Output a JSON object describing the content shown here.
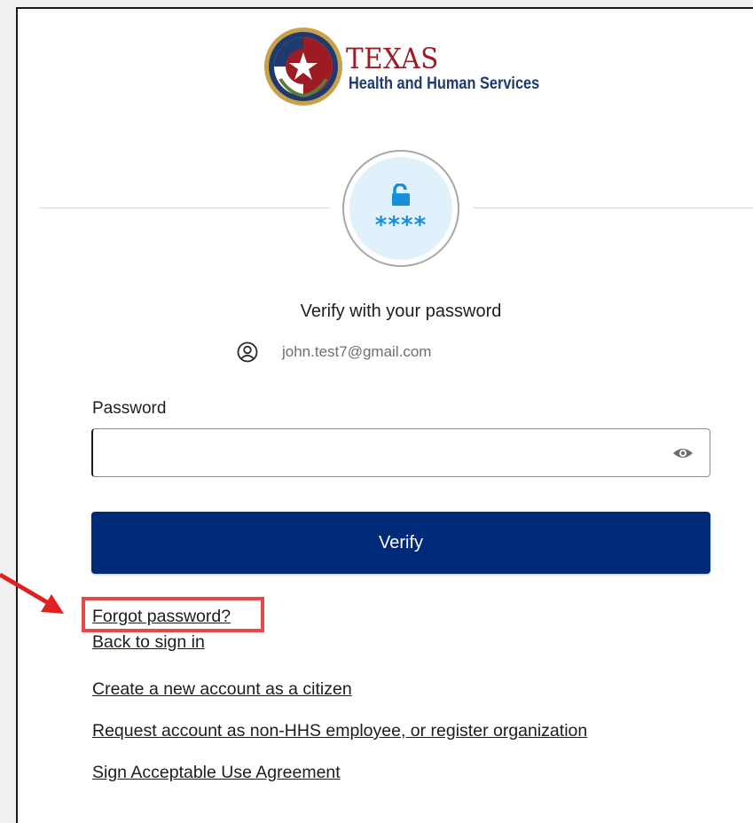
{
  "logo": {
    "line1": "TEXAS",
    "line2": "Health and Human Services"
  },
  "auth_icon": {
    "stars": "****",
    "icon": "lock-icon"
  },
  "title": "Verify with your password",
  "user": {
    "email": "john.test7@gmail.com",
    "icon": "user-icon"
  },
  "password": {
    "label": "Password",
    "value": "",
    "toggle_icon": "eye-icon"
  },
  "verify_button": "Verify",
  "links": {
    "forgot": "Forgot password?",
    "back": "Back to sign in",
    "create": "Create a new account as a citizen",
    "request": "Request account as non-HHS employee, or register organization",
    "sign": "Sign Acceptable Use Agreement"
  },
  "annotation": {
    "highlight_color": "#e94848",
    "arrow_color": "#e02020"
  },
  "colors": {
    "primary_button": "#00297a",
    "brand_red": "#9d1c24",
    "brand_blue": "#1f3a6e",
    "auth_blue": "#1a8fd9"
  }
}
